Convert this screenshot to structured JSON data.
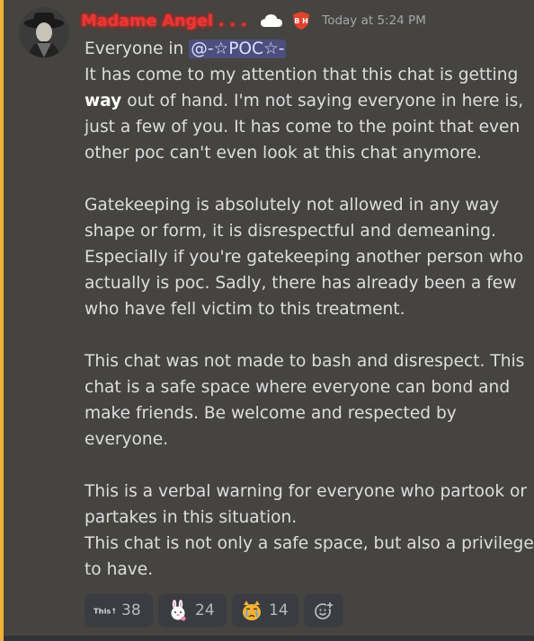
{
  "message": {
    "author": "Madame Angel . . .",
    "timestamp": "Today at 5:24 PM",
    "badge_text": "B H",
    "colors": {
      "username": "#e53935",
      "accent_bar": "#f0b132",
      "background": "#464440"
    },
    "mention": "@-☆POC☆-",
    "lines": {
      "l0": "Everyone in ",
      "l1": "It has come to my attention that this chat is getting",
      "l2_bold": "way",
      "l2_rest": " out of hand. I'm not saying everyone in here is,",
      "l3": "just a few of you. It has come to the point that even",
      "l4": "other poc can't even look at this chat anymore.",
      "p2_1": "Gatekeeping is absolutely not allowed in any way",
      "p2_2": "shape or form, it is disrespectful and demeaning.",
      "p2_3": "Especially if you're gatekeeping another person who",
      "p2_4": "actually is poc. Sadly, there has already been a few",
      "p2_5": "who have fell victim to this treatment.",
      "p3_1": "This chat was not made to bash and disrespect. This",
      "p3_2": "chat is a safe space where everyone can bond and",
      "p3_3": "make friends. Be welcome and respected by",
      "p3_4": "everyone.",
      "p4_1": "This is a verbal warning for everyone who partook or",
      "p4_2": "partakes in this situation.",
      "p4_3": "This chat is not only a safe space, but also a privilege",
      "p4_4": "to have."
    }
  },
  "reactions": [
    {
      "icon": "this-arrow-emoji",
      "label": "This↑",
      "count": "38"
    },
    {
      "icon": "bunny-emoji",
      "count": "24"
    },
    {
      "icon": "crying-cat-emoji",
      "count": "14"
    },
    {
      "icon": "add-reaction-icon"
    }
  ]
}
